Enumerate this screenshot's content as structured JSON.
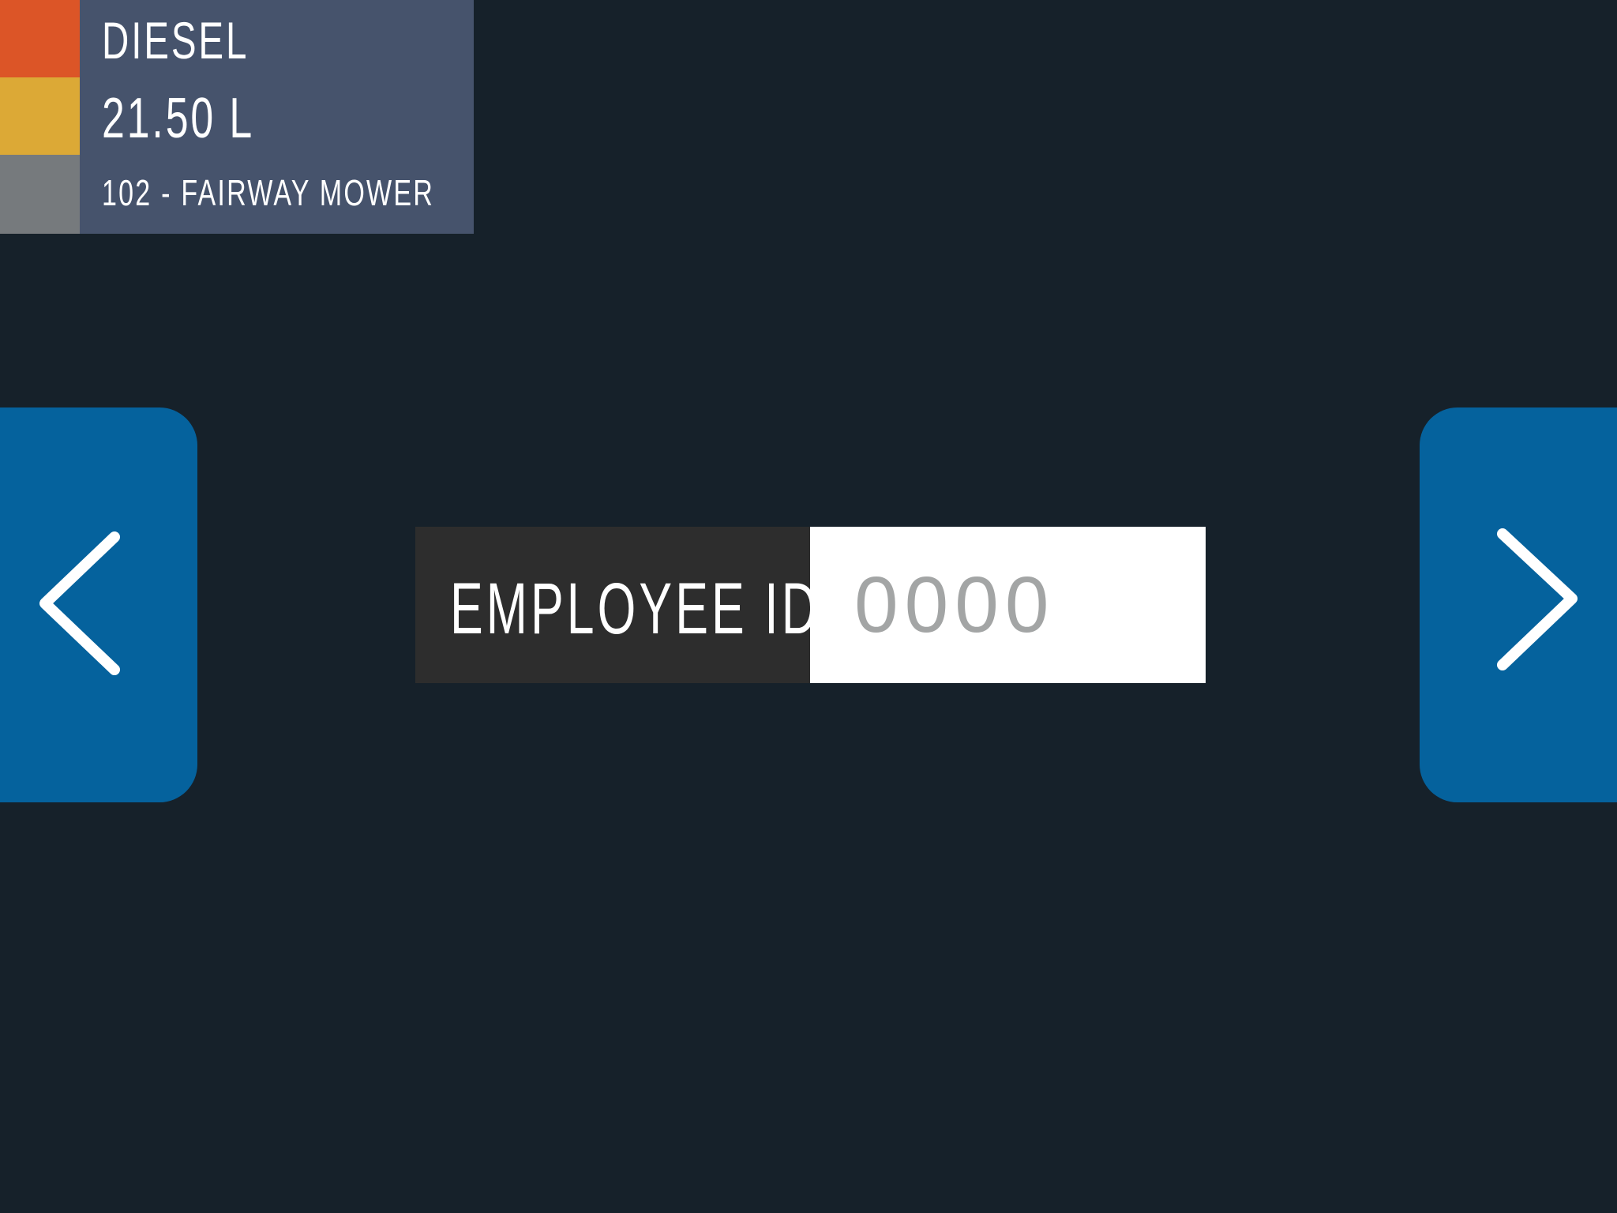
{
  "summary": {
    "fuel_type": "DIESEL",
    "quantity": "21.50 L",
    "equipment": "102 - FAIRWAY MOWER",
    "colors": {
      "fuel": "#dc5527",
      "quantity": "#dca936",
      "equipment": "#767a7d",
      "panel": "#46536c"
    }
  },
  "navigation": {
    "previous_icon": "chevron-left-icon",
    "next_icon": "chevron-right-icon",
    "button_color": "#05629d"
  },
  "employee_field": {
    "label": "EMPLOYEE ID",
    "value": "",
    "placeholder": "0000"
  },
  "theme": {
    "background": "#16212a",
    "label_box": "#2d2d2d"
  }
}
